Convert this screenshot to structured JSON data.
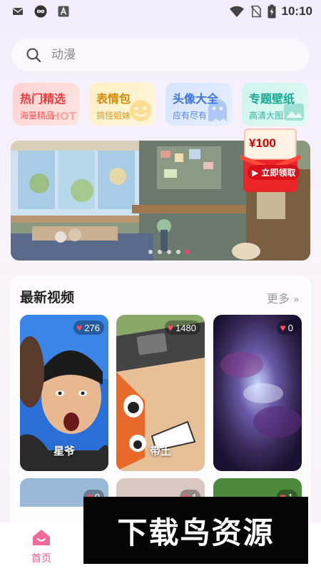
{
  "status_bar": {
    "time": "10:10"
  },
  "search": {
    "placeholder": "动漫"
  },
  "categories": [
    {
      "title": "热门精选",
      "subtitle": "海量精品",
      "deco": "HOT"
    },
    {
      "title": "表情包",
      "subtitle": "搞怪姐妹",
      "deco": ""
    },
    {
      "title": "头像大全",
      "subtitle": "应有尽有",
      "deco": ""
    },
    {
      "title": "专题壁纸",
      "subtitle": "高清大图",
      "deco": ""
    }
  ],
  "banner": {
    "coupon_amount": "¥100",
    "coupon_button": "立即领取",
    "page_count": 5,
    "active_index": 4
  },
  "latest": {
    "title": "最新视频",
    "more_label": "更多",
    "more_chevron": "»",
    "videos": [
      {
        "likes": "276",
        "name": "星爷"
      },
      {
        "likes": "1480",
        "name": "带土"
      },
      {
        "likes": "0",
        "name": ""
      }
    ],
    "second_row": [
      {
        "likes": "0"
      },
      {
        "likes": "4"
      },
      {
        "likes": "1"
      }
    ]
  },
  "nav": {
    "home_label": "首页"
  },
  "watermark": "下载鸟资源",
  "colors": {
    "accent": "#e85a8a",
    "heart": "#ff4f5f",
    "dot_active": "#ff3e6c"
  }
}
